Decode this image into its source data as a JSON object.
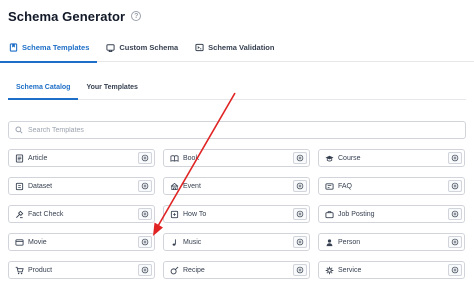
{
  "header": {
    "title": "Schema Generator"
  },
  "main_tabs": [
    {
      "label": "Schema Templates",
      "icon": "bookmark-icon"
    },
    {
      "label": "Custom Schema",
      "icon": "code-icon"
    },
    {
      "label": "Schema Validation",
      "icon": "terminal-icon"
    }
  ],
  "sub_tabs": [
    {
      "label": "Schema Catalog"
    },
    {
      "label": "Your Templates"
    }
  ],
  "search": {
    "placeholder": "Search Templates"
  },
  "items": [
    {
      "label": "Article",
      "icon": "article-icon"
    },
    {
      "label": "Book",
      "icon": "book-icon"
    },
    {
      "label": "Course",
      "icon": "course-icon"
    },
    {
      "label": "Dataset",
      "icon": "dataset-icon"
    },
    {
      "label": "Event",
      "icon": "event-icon"
    },
    {
      "label": "FAQ",
      "icon": "faq-icon"
    },
    {
      "label": "Fact Check",
      "icon": "fact-check-icon"
    },
    {
      "label": "How To",
      "icon": "how-to-icon"
    },
    {
      "label": "Job Posting",
      "icon": "job-posting-icon"
    },
    {
      "label": "Movie",
      "icon": "movie-icon"
    },
    {
      "label": "Music",
      "icon": "music-icon"
    },
    {
      "label": "Person",
      "icon": "person-icon"
    },
    {
      "label": "Product",
      "icon": "product-icon"
    },
    {
      "label": "Recipe",
      "icon": "recipe-icon"
    },
    {
      "label": "Service",
      "icon": "service-icon"
    }
  ],
  "colors": {
    "accent": "#1d6ec6",
    "annotation_arrow": "#e02424"
  }
}
